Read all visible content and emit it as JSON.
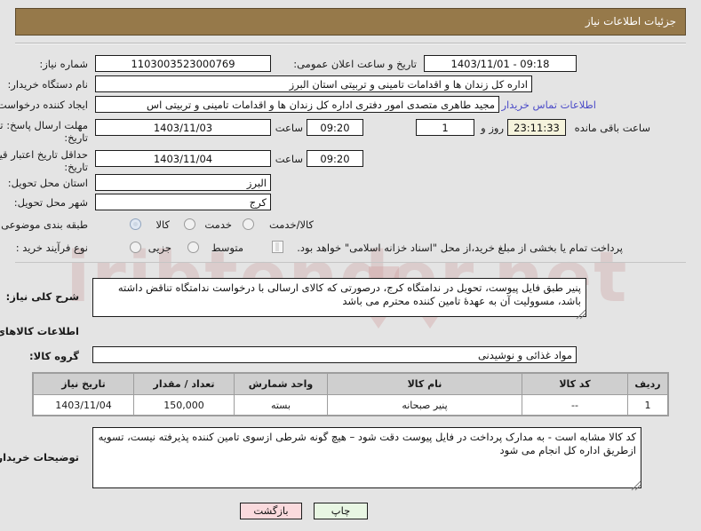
{
  "header": {
    "title": "جزئیات اطلاعات نیاز"
  },
  "form": {
    "need_number_label": "شماره نیاز:",
    "need_number_value": "1103003523000769",
    "announce_label": "تاریخ و ساعت اعلان عمومی:",
    "announce_value": "09:18 - 1403/11/01",
    "buyer_org_label": "نام دستگاه خریدار:",
    "buyer_org_value": "اداره کل زندان ها و اقدامات تامینی و تربیتی استان البرز",
    "creator_label": "ایجاد کننده درخواست:",
    "creator_value": "مجید طاهری متصدی امور دفتری اداره کل زندان ها و اقدامات تامینی و تربیتی اس",
    "buyer_contact_link": "اطلاعات تماس خریدار",
    "deadline_label_line1": "مهلت ارسال پاسخ: تا",
    "deadline_label_line2": "تاریخ:",
    "deadline_date": "1403/11/03",
    "deadline_hour_label": "ساعت",
    "deadline_time": "09:20",
    "remaining_days": "1",
    "remaining_days_label": "روز و",
    "remaining_clock": "23:11:33",
    "remaining_clock_label": "ساعت باقی مانده",
    "validity_label_line1": "حداقل تاریخ اعتبار قیمت: تا",
    "validity_label_line2": "تاریخ:",
    "validity_date": "1403/11/04",
    "validity_hour_label": "ساعت",
    "validity_time": "09:20",
    "province_label": "استان محل تحویل:",
    "province_value": "البرز",
    "city_label": "شهر محل تحویل:",
    "city_value": "کرج",
    "category_label": "طبقه بندی موضوعی:",
    "category_options": [
      "کالا",
      "خدمت",
      "کالا/خدمت"
    ],
    "category_selected_index": 0,
    "process_label": "نوع فرآیند خرید :",
    "process_options": [
      "جزیی",
      "متوسط"
    ],
    "process_selected_index": -1,
    "treasury_checkbox_label": "پرداخت تمام یا بخشی از مبلغ خرید،از محل \"اسناد خزانه اسلامی\" خواهد بود.",
    "treasury_checked": false
  },
  "description": {
    "label": "شرح کلی نیاز:",
    "text": "پنیر طبق فایل پیوست، تحویل در ندامتگاه کرج، درصورتی که کالای ارسالی با درخواست ندامتگاه تناقض داشته باشد، مسوولیت آن به عهدۀ تامین کننده محترم می باشد"
  },
  "goods_section": {
    "heading": "اطلاعات کالاهای مورد نیاز",
    "group_label": "گروه کالا:",
    "group_value": "مواد غذائی و نوشیدنی",
    "columns": [
      "ردیف",
      "کد کالا",
      "نام کالا",
      "واحد شمارش",
      "تعداد / مقدار",
      "تاریخ نیاز"
    ],
    "rows": [
      {
        "row": "1",
        "code": "--",
        "name": "پنیر صبحانه",
        "unit": "بسته",
        "quantity": "150,000",
        "need_date": "1403/11/04"
      }
    ]
  },
  "buyer_notes": {
    "label": "توضیحات خریدار:",
    "text": "کد کالا مشابه است - به مدارک پرداخت در فایل پیوست دقت شود – هیچ گونه شرطی ازسوی تامین کننده پذیرفته نیست، تسویه ازطریق اداره کل انجام می شود"
  },
  "footer": {
    "print_label": "چاپ",
    "back_label": "بازگشت"
  },
  "watermark": {
    "text": "iribtender.net"
  },
  "colors": {
    "header_bg": "#96794a",
    "page_bg": "#e4e4e4",
    "link": "#4c4cc8",
    "print_btn": "#e8f6e3",
    "back_btn": "#fadadd",
    "cream_field": "#f5f3dc"
  }
}
